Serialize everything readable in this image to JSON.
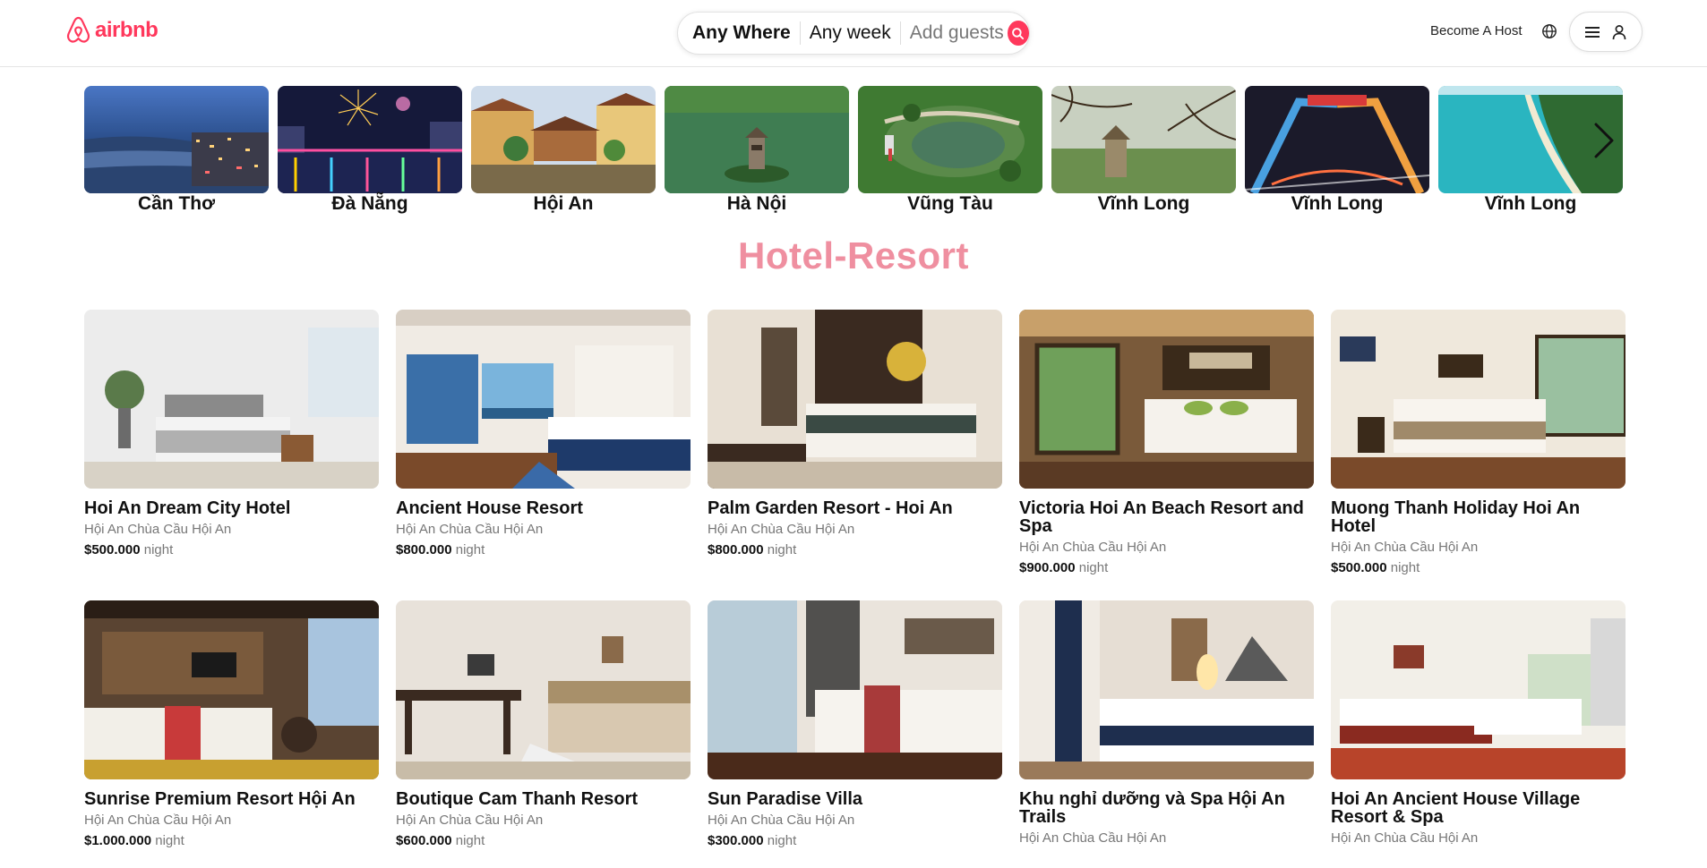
{
  "brand": {
    "name": "airbnb",
    "color": "#ff385c"
  },
  "search": {
    "where": "Any Where",
    "week": "Any week",
    "guests": "Add guests",
    "button_icon": "search-icon"
  },
  "nav": {
    "host_label": "Become A Host",
    "globe_icon": "globe-icon",
    "menu_icon": "hamburger-icon",
    "user_icon": "user-icon"
  },
  "destinations": [
    {
      "name": "Cần Thơ"
    },
    {
      "name": "Đà Nẵng"
    },
    {
      "name": "Hội An"
    },
    {
      "name": "Hà Nội"
    },
    {
      "name": "Vũng Tàu"
    },
    {
      "name": "Vĩnh Long"
    },
    {
      "name": "Vĩnh Long"
    },
    {
      "name": "Vĩnh Long"
    }
  ],
  "section_title": "Hotel-Resort",
  "listings": [
    {
      "title": "Hoi An Dream City Hotel",
      "location": "Hội An Chùa Cầu Hội An",
      "price": "$500.000",
      "unit": "night"
    },
    {
      "title": "Ancient House Resort",
      "location": "Hội An Chùa Cầu Hội An",
      "price": "$800.000",
      "unit": "night"
    },
    {
      "title": "Palm Garden Resort - Hoi An",
      "location": "Hội An Chùa Cầu Hội An",
      "price": "$800.000",
      "unit": "night"
    },
    {
      "title": "Victoria Hoi An Beach Resort and Spa",
      "location": "Hội An Chùa Cầu Hội An",
      "price": "$900.000",
      "unit": "night"
    },
    {
      "title": "Muong Thanh Holiday Hoi An Hotel",
      "location": "Hội An Chùa Cầu Hội An",
      "price": "$500.000",
      "unit": "night"
    },
    {
      "title": "Sunrise Premium Resort Hội An",
      "location": "Hội An Chùa Cầu Hội An",
      "price": "$1.000.000",
      "unit": "night"
    },
    {
      "title": "Boutique Cam Thanh Resort",
      "location": "Hội An Chùa Cầu Hội An",
      "price": "$600.000",
      "unit": "night"
    },
    {
      "title": "Sun Paradise Villa",
      "location": "Hội An Chùa Cầu Hội An",
      "price": "$300.000",
      "unit": "night"
    },
    {
      "title": "Khu nghỉ dưỡng và Spa Hội An Trails",
      "location": "Hội An Chùa Cầu Hội An",
      "price": "",
      "unit": ""
    },
    {
      "title": "Hoi An Ancient House Village Resort & Spa",
      "location": "Hội An Chùa Cầu Hội An",
      "price": "",
      "unit": ""
    }
  ]
}
